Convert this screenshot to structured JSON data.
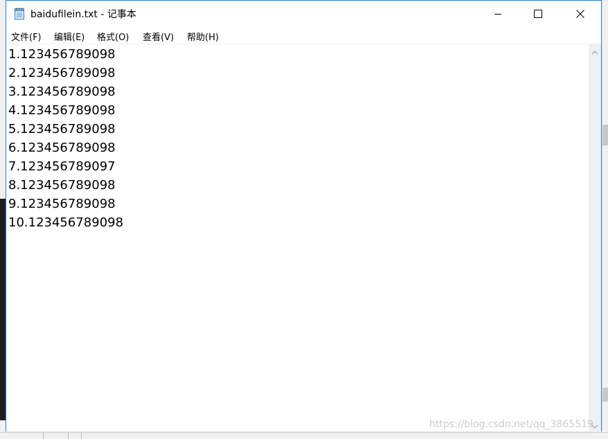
{
  "window": {
    "title": "baidufilein.txt - 记事本"
  },
  "menu": {
    "items": [
      {
        "label": "文件(F)"
      },
      {
        "label": "编辑(E)"
      },
      {
        "label": "格式(O)"
      },
      {
        "label": "查看(V)"
      },
      {
        "label": "帮助(H)"
      }
    ]
  },
  "editor": {
    "lines": [
      "1.123456789098",
      "2.123456789098",
      "3.123456789098",
      "4.123456789098",
      "5.123456789098",
      "6.123456789098",
      "7.123456789097",
      "8.123456789098",
      "9.123456789098",
      "10.123456789098"
    ]
  },
  "icons": {
    "app": "notepad-icon",
    "minimize": "minimize-icon",
    "maximize": "maximize-icon",
    "close": "close-icon",
    "scroll_up": "chevron-up-icon",
    "scroll_down": "chevron-down-icon"
  },
  "colors": {
    "window_border": "#1883d7",
    "text": "#000000",
    "background": "#ffffff"
  },
  "watermark": "https://blog.csdn.net/qq_3865519"
}
